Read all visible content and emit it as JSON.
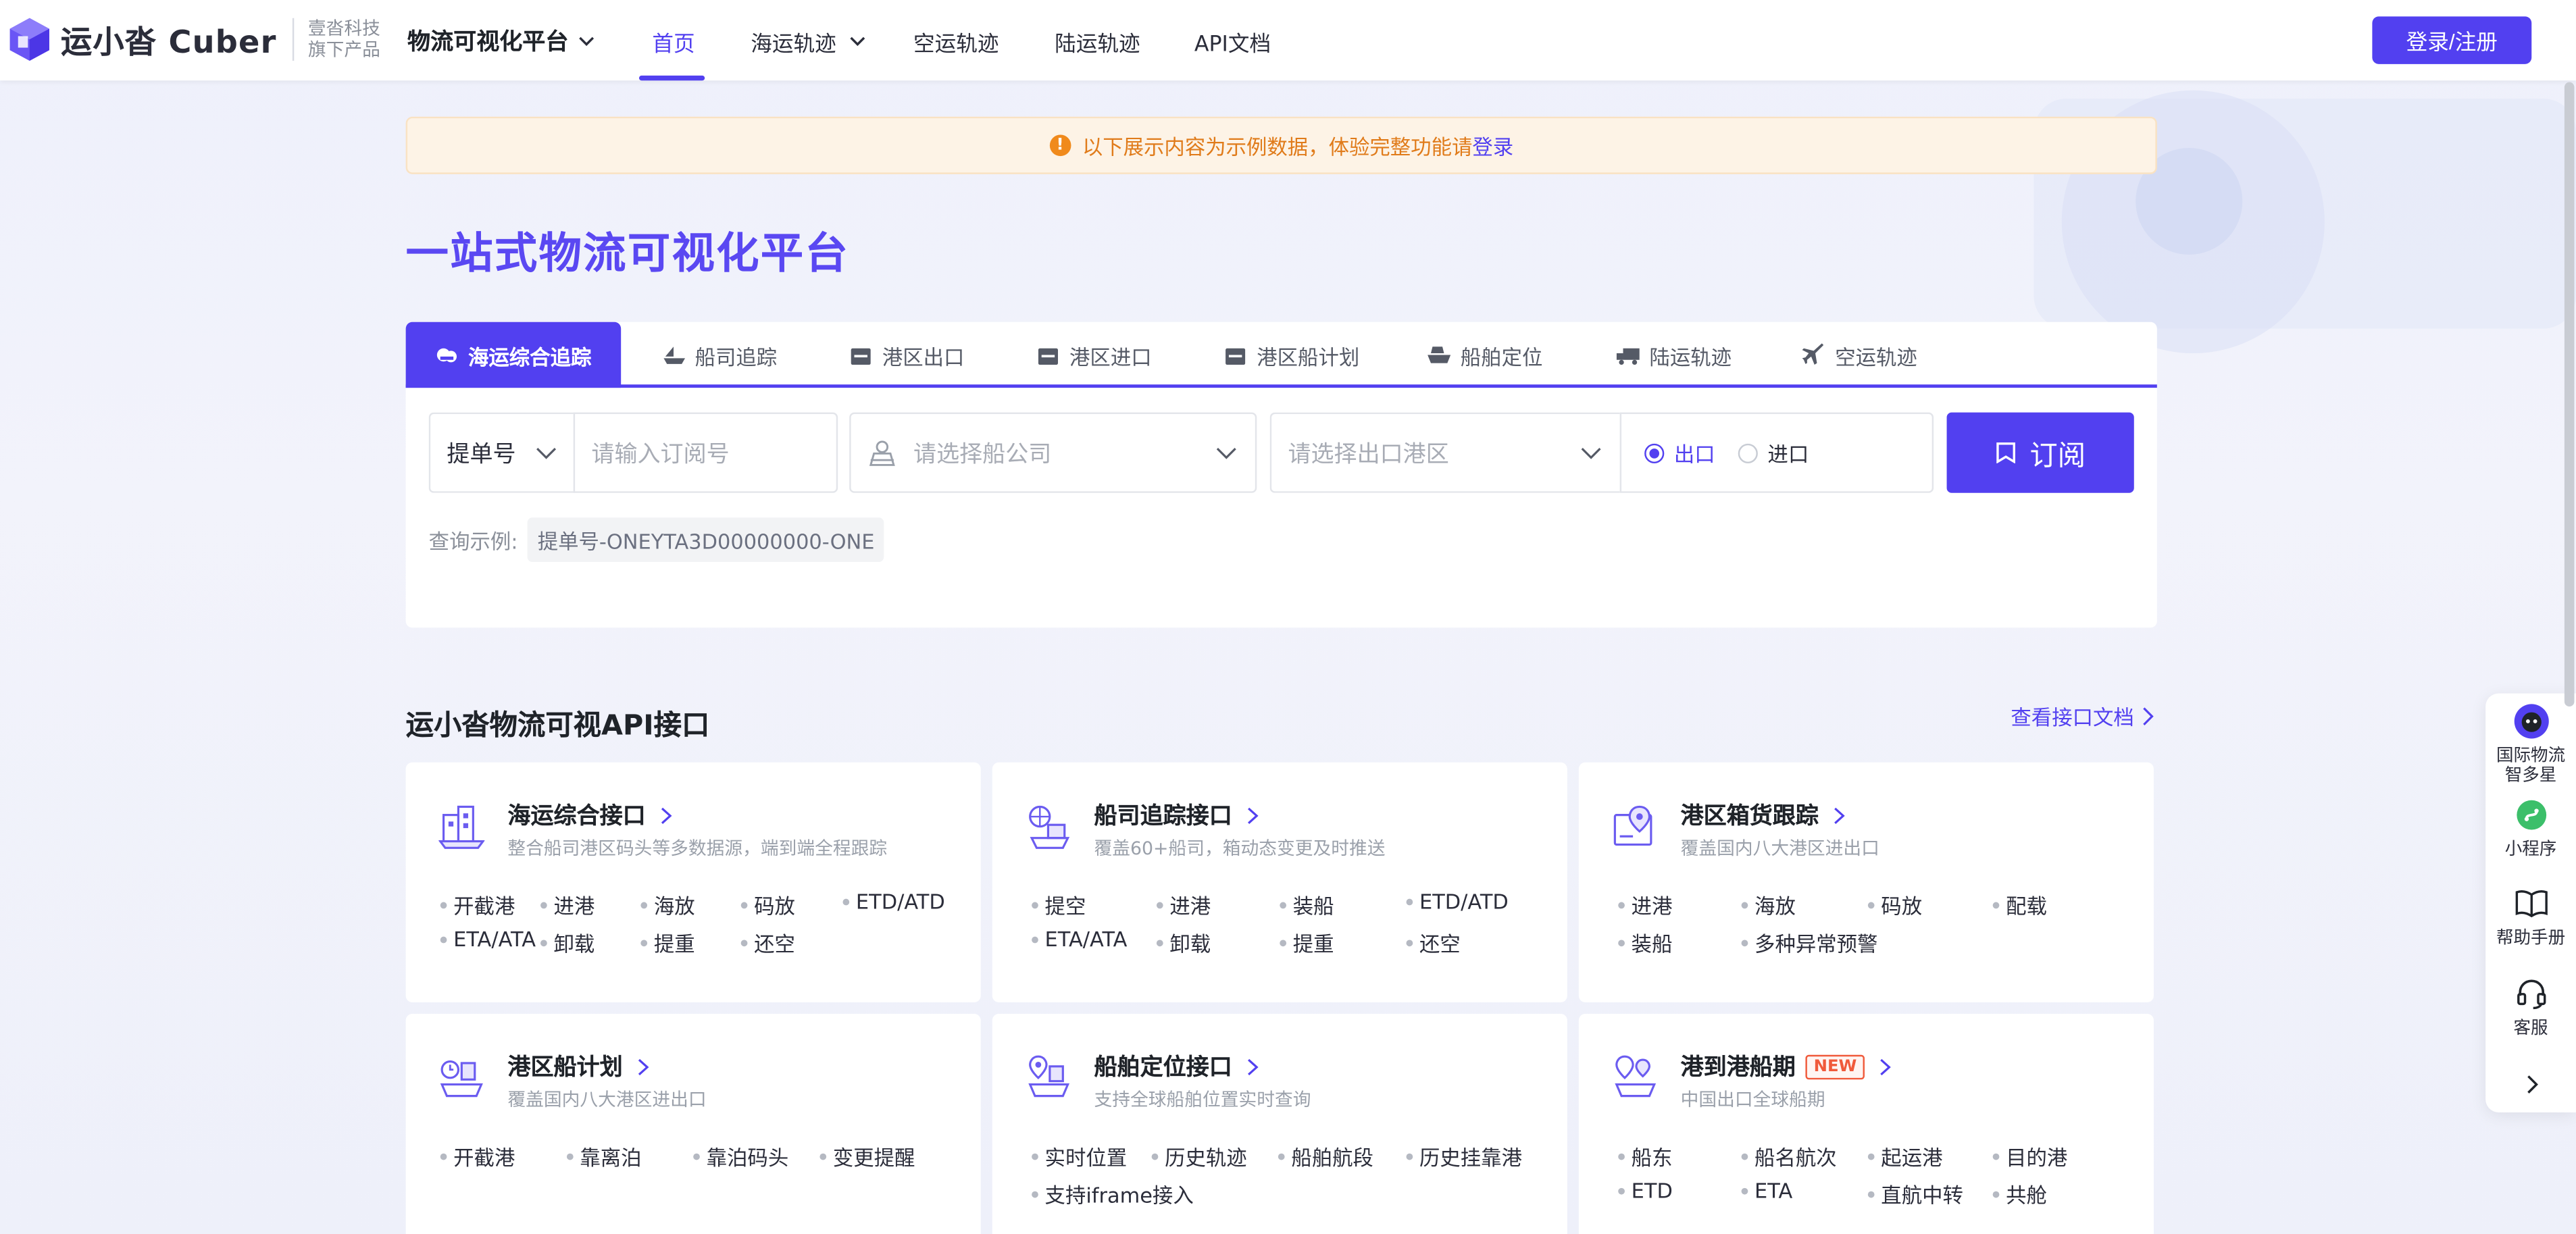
{
  "brand": {
    "logo_text": "运小沓 Cuber",
    "sub_line1": "壹沓科技",
    "sub_line2": "旗下产品"
  },
  "nav": {
    "platform": "物流可视化平台",
    "items": [
      "首页",
      "海运轨迹",
      "空运轨迹",
      "陆运轨迹",
      "API文档"
    ],
    "active": "首页",
    "login": "登录/注册"
  },
  "notice": {
    "text": "以下展示内容为示例数据，体验完整功能请",
    "link": "登录"
  },
  "hero_title": "一站式物流可视化平台",
  "tabs": [
    "海运综合追踪",
    "船司追踪",
    "港区出口",
    "港区进口",
    "港区船计划",
    "船舶定位",
    "陆运轨迹",
    "空运轨迹"
  ],
  "search": {
    "type_select": "提单号",
    "number_placeholder": "请输入订阅号",
    "carrier_placeholder": "请选择船公司",
    "port_placeholder": "请选择出口港区",
    "radio_export": "出口",
    "radio_import": "进口",
    "submit": "订阅",
    "example_label": "查询示例:",
    "example_value": "提单号-ONEYTA3D00000000-ONE"
  },
  "api_section": {
    "title": "运小沓物流可视API接口",
    "doc_link": "查看接口文档"
  },
  "api_cards": [
    {
      "title": "海运综合接口",
      "desc": "整合船司港区码头等多数据源，端到端全程跟踪",
      "features": [
        "开截港",
        "进港",
        "海放",
        "码放",
        "ETD/ATD",
        "ETA/ATA",
        "卸载",
        "提重",
        "还空"
      ]
    },
    {
      "title": "船司追踪接口",
      "desc": "覆盖60+船司，箱动态变更及时推送",
      "features": [
        "提空",
        "进港",
        "装船",
        "ETD/ATD",
        "ETA/ATA",
        "卸载",
        "提重",
        "还空"
      ]
    },
    {
      "title": "港区箱货跟踪",
      "desc": "覆盖国内八大港区进出口",
      "features": [
        "进港",
        "海放",
        "码放",
        "配载",
        "装船",
        "多种异常预警"
      ]
    },
    {
      "title": "港区船计划",
      "desc": "覆盖国内八大港区进出口",
      "features": [
        "开截港",
        "靠离泊",
        "靠泊码头",
        "变更提醒"
      ]
    },
    {
      "title": "船舶定位接口",
      "desc": "支持全球船舶位置实时查询",
      "features": [
        "实时位置",
        "历史轨迹",
        "船舶航段",
        "历史挂靠港",
        "支持iframe接入"
      ]
    },
    {
      "title": "港到港船期",
      "desc": "中国出口全球船期",
      "badge": "NEW",
      "features": [
        "船东",
        "船名航次",
        "起运港",
        "目的港",
        "ETD",
        "ETA",
        "直航中转",
        "共舱"
      ]
    }
  ],
  "side_panel": [
    "国际物流智多星",
    "小程序",
    "帮助手册",
    "客服"
  ],
  "colors": {
    "accent": "#5240f0",
    "hero": "#5a48f2",
    "notice_bg": "#fdf3e6",
    "notice_text": "#e07b1a",
    "new_badge": "#f05a3b"
  }
}
